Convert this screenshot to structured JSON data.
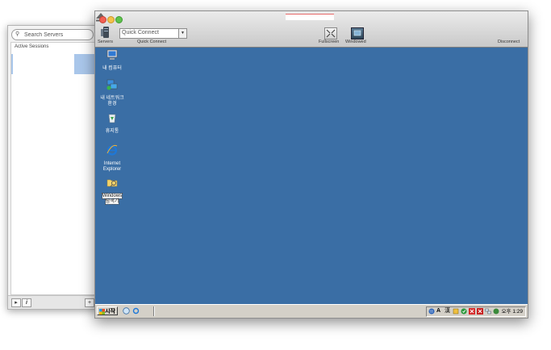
{
  "side_panel": {
    "search_placeholder": "Search Servers",
    "sessions_heading": "Active Sessions",
    "bottom_buttons": [
      "▸",
      "i",
      "+"
    ]
  },
  "toolbar": {
    "servers_label": "Servers",
    "quick_connect_value": "Quick Connect",
    "quick_connect_label": "Quick Connect",
    "fullscreen_label": "Fullscreen",
    "windowed_label": "Windowed",
    "disconnect_label": "Disconnect"
  },
  "desktop": {
    "background_color": "#3a6ea5",
    "icons": [
      {
        "lines": [
          "내 컴퓨터"
        ],
        "icon": "my-computer-icon"
      },
      {
        "lines": [
          "내 네트워크",
          "환경"
        ],
        "icon": "network-places-icon"
      },
      {
        "lines": [
          "휴지통"
        ],
        "icon": "recycle-bin-icon"
      },
      {
        "lines": [
          "Internet",
          "Explorer"
        ],
        "icon": "internet-explorer-icon"
      },
      {
        "lines": [
          "Windows",
          "탐색기"
        ],
        "icon": "windows-explorer-icon"
      }
    ]
  },
  "taskbar": {
    "start_label": "시작",
    "tray_lang": "A",
    "tray_han": "漢",
    "clock": "오후 1:29"
  }
}
